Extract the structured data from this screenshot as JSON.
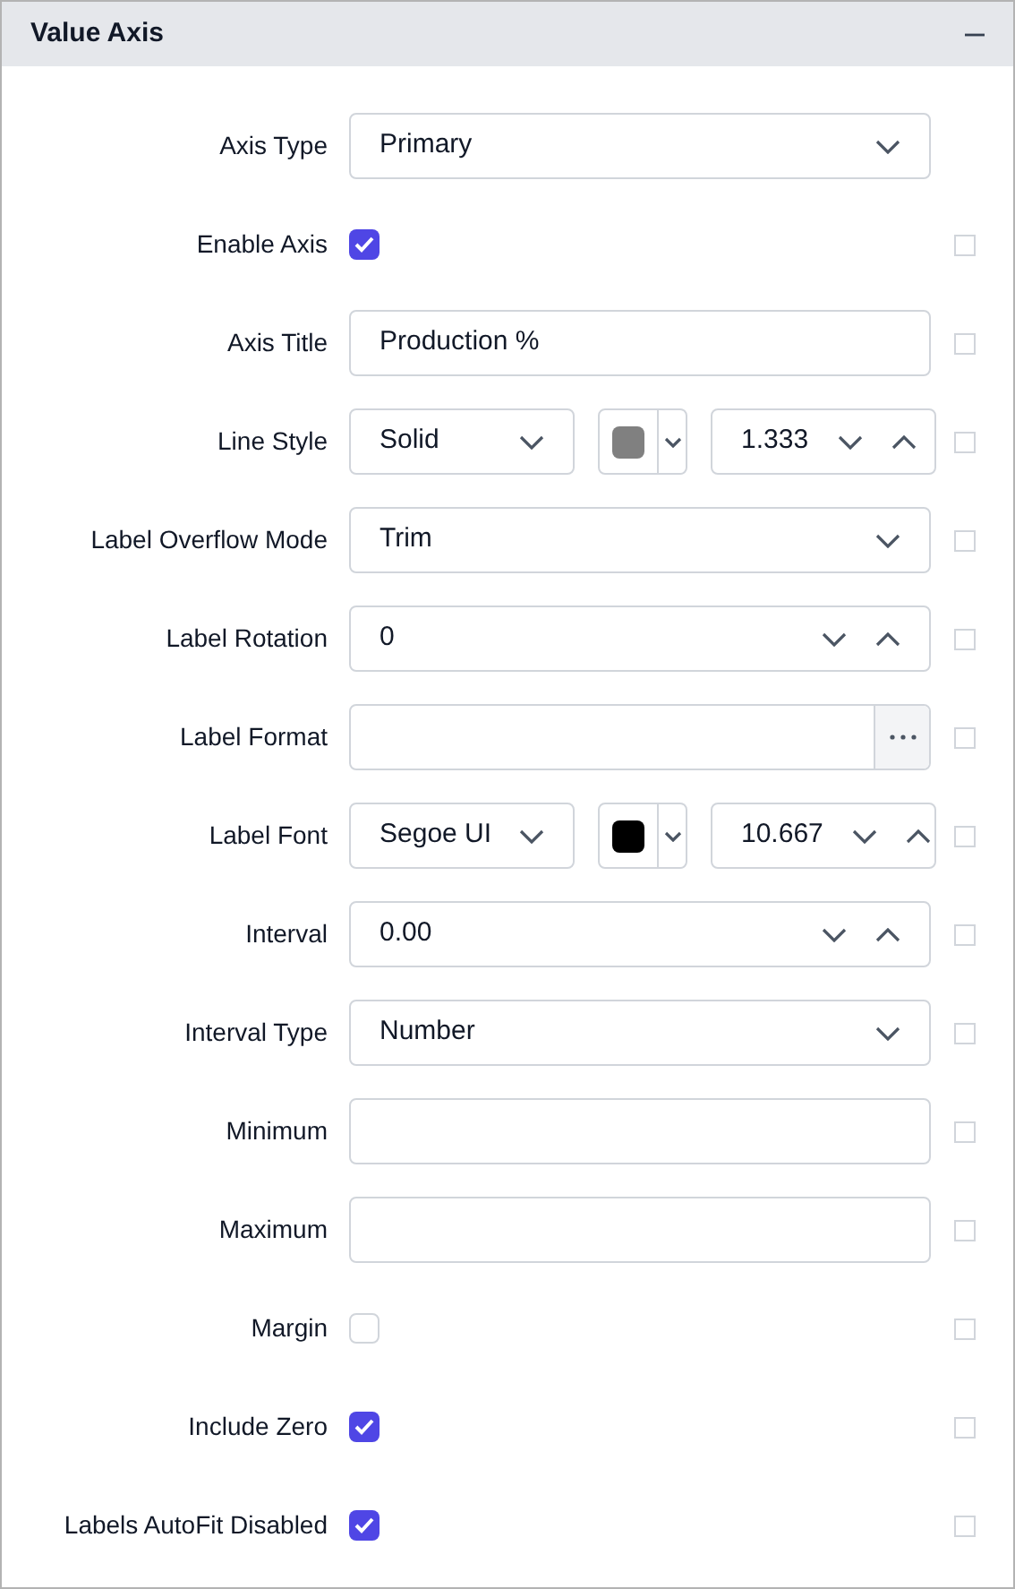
{
  "panel": {
    "title": "Value Axis",
    "expanded": true
  },
  "rows": [
    {
      "kind": "dropdown",
      "label": "Axis Type",
      "value": "Primary"
    },
    {
      "kind": "checkbox",
      "label": "Enable Axis",
      "checked": true,
      "side_checked": false
    },
    {
      "kind": "text",
      "label": "Axis Title",
      "value": "Production %",
      "side_checked": false
    },
    {
      "kind": "combo",
      "label": "Line Style",
      "value": "Solid",
      "color": "#808080",
      "number": "1.333",
      "side_checked": false
    },
    {
      "kind": "dropdown",
      "label": "Label Overflow Mode",
      "value": "Trim",
      "side_checked": false
    },
    {
      "kind": "numeric",
      "label": "Label Rotation",
      "value": "0",
      "side_checked": false
    },
    {
      "kind": "browse",
      "label": "Label Format",
      "value": "",
      "side_checked": false
    },
    {
      "kind": "combo",
      "label": "Label Font",
      "value": "Segoe UI",
      "color": "#000000",
      "number": "10.667",
      "side_checked": false
    },
    {
      "kind": "numeric",
      "label": "Interval",
      "value": "0.00",
      "side_checked": false
    },
    {
      "kind": "dropdown",
      "label": "Interval Type",
      "value": "Number",
      "side_checked": false
    },
    {
      "kind": "text",
      "label": "Minimum",
      "value": "",
      "side_checked": false
    },
    {
      "kind": "text",
      "label": "Maximum",
      "value": "",
      "side_checked": false
    },
    {
      "kind": "checkbox",
      "label": "Margin",
      "checked": false,
      "side_checked": false
    },
    {
      "kind": "checkbox",
      "label": "Include Zero",
      "checked": true,
      "side_checked": false
    },
    {
      "kind": "checkbox",
      "label": "Labels AutoFit Disabled",
      "checked": true,
      "side_checked": false
    }
  ]
}
